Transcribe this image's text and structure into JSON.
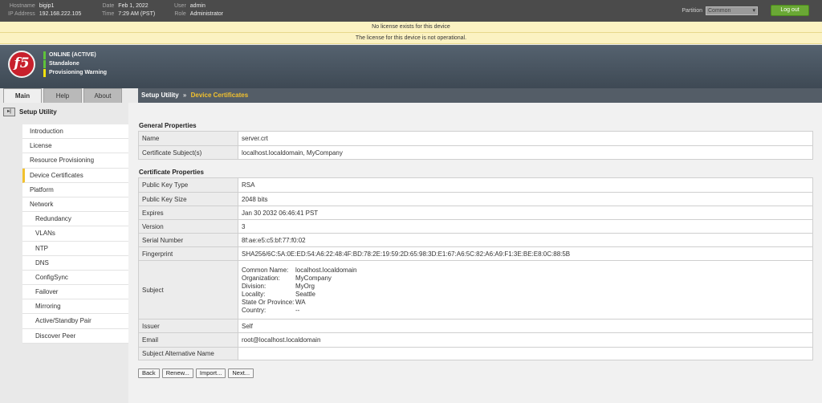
{
  "topbar": {
    "hostname_label": "Hostname",
    "hostname": "bigip1",
    "ip_label": "IP Address",
    "ip": "192.168.222.105",
    "date_label": "Date",
    "date": "Feb 1, 2022",
    "time_label": "Time",
    "time": "7:29 AM (PST)",
    "user_label": "User",
    "user": "admin",
    "role_label": "Role",
    "role": "Administrator",
    "partition_label": "Partition",
    "partition_value": "Common",
    "logout_label": "Log out"
  },
  "banners": {
    "line1": "No license exists for this device",
    "line2": "The license for this device is not operational."
  },
  "logo_text": "f5",
  "status": {
    "items": [
      {
        "label": "ONLINE (ACTIVE)",
        "color": "#5fc33a"
      },
      {
        "label": "Standalone",
        "color": "#5fc33a"
      },
      {
        "label": "Provisioning Warning",
        "color": "#f4e20d"
      }
    ]
  },
  "tabs": [
    "Main",
    "Help",
    "About"
  ],
  "breadcrumb": {
    "parent": "Setup Utility",
    "separator": "»",
    "current": "Device Certificates"
  },
  "sidebar": {
    "header": "Setup Utility",
    "items": [
      {
        "label": "Introduction"
      },
      {
        "label": "License"
      },
      {
        "label": "Resource Provisioning"
      },
      {
        "label": "Device Certificates"
      },
      {
        "label": "Platform"
      },
      {
        "label": "Network"
      },
      {
        "label": "Redundancy"
      },
      {
        "label": "VLANs"
      },
      {
        "label": "NTP"
      },
      {
        "label": "DNS"
      },
      {
        "label": "ConfigSync"
      },
      {
        "label": "Failover"
      },
      {
        "label": "Mirroring"
      },
      {
        "label": "Active/Standby Pair"
      },
      {
        "label": "Discover Peer"
      }
    ]
  },
  "general": {
    "title": "General Properties",
    "rows": [
      {
        "label": "Name",
        "value": "server.crt"
      },
      {
        "label": "Certificate Subject(s)",
        "value": "localhost.localdomain, MyCompany"
      }
    ]
  },
  "certificate": {
    "title": "Certificate Properties",
    "rows": [
      {
        "label": "Public Key Type",
        "value": "RSA"
      },
      {
        "label": "Public Key Size",
        "value": "2048 bits"
      },
      {
        "label": "Expires",
        "value": "Jan 30 2032 06:46:41 PST"
      },
      {
        "label": "Version",
        "value": "3"
      },
      {
        "label": "Serial Number",
        "value": "8f:ae:e5:c5:bf:77:f0:02"
      },
      {
        "label": "Fingerprint",
        "value": "SHA256/6C:5A:0E:ED:54:A6:22:48:4F:BD:78:2E:19:59:2D:65:98:3D:E1:67:A6:5C:82:A6:A9:F1:3E:BE:E8:0C:88:5B"
      }
    ],
    "subject_label": "Subject",
    "subject": [
      {
        "k": "Common Name:",
        "v": "localhost.localdomain"
      },
      {
        "k": "Organization:",
        "v": "MyCompany"
      },
      {
        "k": "Division:",
        "v": "MyOrg"
      },
      {
        "k": "Locality:",
        "v": "Seattle"
      },
      {
        "k": "State Or Province:",
        "v": "WA"
      },
      {
        "k": "Country:",
        "v": "--"
      }
    ],
    "rows_after": [
      {
        "label": "Issuer",
        "value": "Self"
      },
      {
        "label": "Email",
        "value": "root@localhost.localdomain"
      },
      {
        "label": "Subject Alternative Name",
        "value": ""
      }
    ]
  },
  "buttons": {
    "back": "Back",
    "renew": "Renew...",
    "import": "Import...",
    "next": "Next..."
  }
}
